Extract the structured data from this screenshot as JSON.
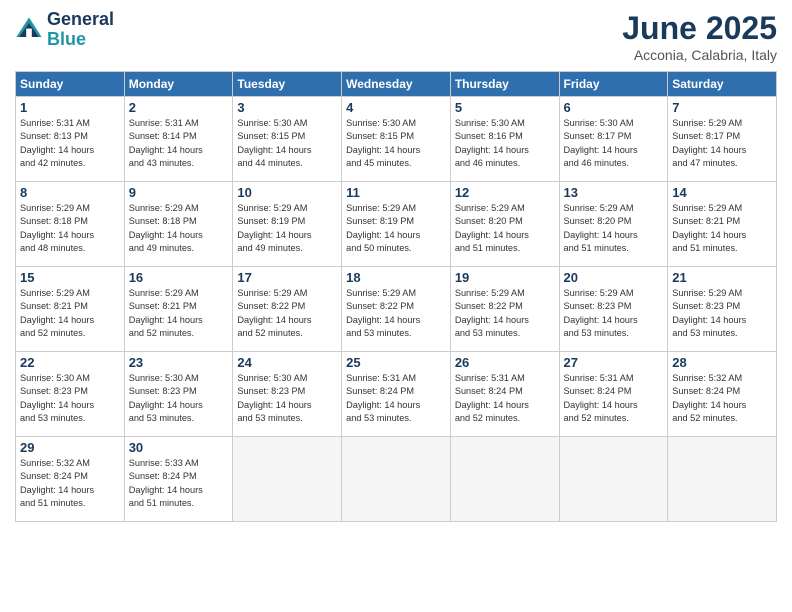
{
  "logo": {
    "line1": "General",
    "line2": "Blue"
  },
  "title": "June 2025",
  "location": "Acconia, Calabria, Italy",
  "days_of_week": [
    "Sunday",
    "Monday",
    "Tuesday",
    "Wednesday",
    "Thursday",
    "Friday",
    "Saturday"
  ],
  "weeks": [
    [
      {
        "day": 1,
        "info": "Sunrise: 5:31 AM\nSunset: 8:13 PM\nDaylight: 14 hours\nand 42 minutes."
      },
      {
        "day": 2,
        "info": "Sunrise: 5:31 AM\nSunset: 8:14 PM\nDaylight: 14 hours\nand 43 minutes."
      },
      {
        "day": 3,
        "info": "Sunrise: 5:30 AM\nSunset: 8:15 PM\nDaylight: 14 hours\nand 44 minutes."
      },
      {
        "day": 4,
        "info": "Sunrise: 5:30 AM\nSunset: 8:15 PM\nDaylight: 14 hours\nand 45 minutes."
      },
      {
        "day": 5,
        "info": "Sunrise: 5:30 AM\nSunset: 8:16 PM\nDaylight: 14 hours\nand 46 minutes."
      },
      {
        "day": 6,
        "info": "Sunrise: 5:30 AM\nSunset: 8:17 PM\nDaylight: 14 hours\nand 46 minutes."
      },
      {
        "day": 7,
        "info": "Sunrise: 5:29 AM\nSunset: 8:17 PM\nDaylight: 14 hours\nand 47 minutes."
      }
    ],
    [
      {
        "day": 8,
        "info": "Sunrise: 5:29 AM\nSunset: 8:18 PM\nDaylight: 14 hours\nand 48 minutes."
      },
      {
        "day": 9,
        "info": "Sunrise: 5:29 AM\nSunset: 8:18 PM\nDaylight: 14 hours\nand 49 minutes."
      },
      {
        "day": 10,
        "info": "Sunrise: 5:29 AM\nSunset: 8:19 PM\nDaylight: 14 hours\nand 49 minutes."
      },
      {
        "day": 11,
        "info": "Sunrise: 5:29 AM\nSunset: 8:19 PM\nDaylight: 14 hours\nand 50 minutes."
      },
      {
        "day": 12,
        "info": "Sunrise: 5:29 AM\nSunset: 8:20 PM\nDaylight: 14 hours\nand 51 minutes."
      },
      {
        "day": 13,
        "info": "Sunrise: 5:29 AM\nSunset: 8:20 PM\nDaylight: 14 hours\nand 51 minutes."
      },
      {
        "day": 14,
        "info": "Sunrise: 5:29 AM\nSunset: 8:21 PM\nDaylight: 14 hours\nand 51 minutes."
      }
    ],
    [
      {
        "day": 15,
        "info": "Sunrise: 5:29 AM\nSunset: 8:21 PM\nDaylight: 14 hours\nand 52 minutes."
      },
      {
        "day": 16,
        "info": "Sunrise: 5:29 AM\nSunset: 8:21 PM\nDaylight: 14 hours\nand 52 minutes."
      },
      {
        "day": 17,
        "info": "Sunrise: 5:29 AM\nSunset: 8:22 PM\nDaylight: 14 hours\nand 52 minutes."
      },
      {
        "day": 18,
        "info": "Sunrise: 5:29 AM\nSunset: 8:22 PM\nDaylight: 14 hours\nand 53 minutes."
      },
      {
        "day": 19,
        "info": "Sunrise: 5:29 AM\nSunset: 8:22 PM\nDaylight: 14 hours\nand 53 minutes."
      },
      {
        "day": 20,
        "info": "Sunrise: 5:29 AM\nSunset: 8:23 PM\nDaylight: 14 hours\nand 53 minutes."
      },
      {
        "day": 21,
        "info": "Sunrise: 5:29 AM\nSunset: 8:23 PM\nDaylight: 14 hours\nand 53 minutes."
      }
    ],
    [
      {
        "day": 22,
        "info": "Sunrise: 5:30 AM\nSunset: 8:23 PM\nDaylight: 14 hours\nand 53 minutes."
      },
      {
        "day": 23,
        "info": "Sunrise: 5:30 AM\nSunset: 8:23 PM\nDaylight: 14 hours\nand 53 minutes."
      },
      {
        "day": 24,
        "info": "Sunrise: 5:30 AM\nSunset: 8:23 PM\nDaylight: 14 hours\nand 53 minutes."
      },
      {
        "day": 25,
        "info": "Sunrise: 5:31 AM\nSunset: 8:24 PM\nDaylight: 14 hours\nand 53 minutes."
      },
      {
        "day": 26,
        "info": "Sunrise: 5:31 AM\nSunset: 8:24 PM\nDaylight: 14 hours\nand 52 minutes."
      },
      {
        "day": 27,
        "info": "Sunrise: 5:31 AM\nSunset: 8:24 PM\nDaylight: 14 hours\nand 52 minutes."
      },
      {
        "day": 28,
        "info": "Sunrise: 5:32 AM\nSunset: 8:24 PM\nDaylight: 14 hours\nand 52 minutes."
      }
    ],
    [
      {
        "day": 29,
        "info": "Sunrise: 5:32 AM\nSunset: 8:24 PM\nDaylight: 14 hours\nand 51 minutes."
      },
      {
        "day": 30,
        "info": "Sunrise: 5:33 AM\nSunset: 8:24 PM\nDaylight: 14 hours\nand 51 minutes."
      },
      null,
      null,
      null,
      null,
      null
    ]
  ]
}
